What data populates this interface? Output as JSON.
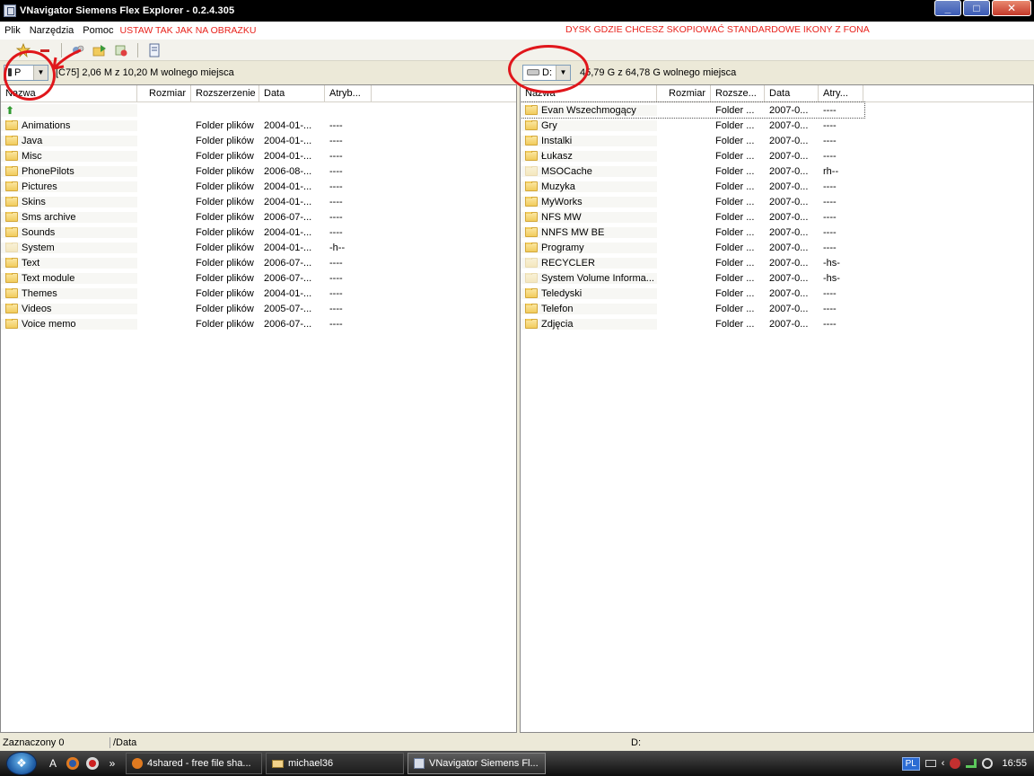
{
  "window": {
    "title": "VNavigator Siemens Flex Explorer - 0.2.4.305",
    "buttons": {
      "minimize": "_",
      "maximize": "□",
      "close": "✕"
    }
  },
  "menu": {
    "items": [
      "Plik",
      "Narzędzia",
      "Pomoc"
    ],
    "note_left": "USTAW TAK JAK NA OBRAZKU",
    "note_right": "DYSK GDZIE CHCESZ SKOPIOWAĆ STANDARDOWE IKONY Z FONA"
  },
  "left": {
    "drive": "P",
    "free": "[C75] 2,06 M z 10,20 M wolnego miejsca",
    "columns": [
      "Nazwa",
      "Rozmiar",
      "Rozszerzenie",
      "Data",
      "Atryb..."
    ],
    "rows": [
      {
        "name": "Animations",
        "size": "",
        "ext": "Folder plików",
        "date": "2004-01-...",
        "attr": "----"
      },
      {
        "name": "Java",
        "size": "",
        "ext": "Folder plików",
        "date": "2004-01-...",
        "attr": "----"
      },
      {
        "name": "Misc",
        "size": "",
        "ext": "Folder plików",
        "date": "2004-01-...",
        "attr": "----"
      },
      {
        "name": "PhonePilots",
        "size": "",
        "ext": "Folder plików",
        "date": "2006-08-...",
        "attr": "----"
      },
      {
        "name": "Pictures",
        "size": "",
        "ext": "Folder plików",
        "date": "2004-01-...",
        "attr": "----"
      },
      {
        "name": "Skins",
        "size": "",
        "ext": "Folder plików",
        "date": "2004-01-...",
        "attr": "----"
      },
      {
        "name": "Sms archive",
        "size": "",
        "ext": "Folder plików",
        "date": "2006-07-...",
        "attr": "----"
      },
      {
        "name": "Sounds",
        "size": "",
        "ext": "Folder plików",
        "date": "2004-01-...",
        "attr": "----"
      },
      {
        "name": "System",
        "size": "",
        "ext": "Folder plików",
        "date": "2004-01-...",
        "attr": "-h--"
      },
      {
        "name": "Text",
        "size": "",
        "ext": "Folder plików",
        "date": "2006-07-...",
        "attr": "----"
      },
      {
        "name": "Text module",
        "size": "",
        "ext": "Folder plików",
        "date": "2006-07-...",
        "attr": "----"
      },
      {
        "name": "Themes",
        "size": "",
        "ext": "Folder plików",
        "date": "2004-01-...",
        "attr": "----"
      },
      {
        "name": "Videos",
        "size": "",
        "ext": "Folder plików",
        "date": "2005-07-...",
        "attr": "----"
      },
      {
        "name": "Voice memo",
        "size": "",
        "ext": "Folder plików",
        "date": "2006-07-...",
        "attr": "----"
      }
    ],
    "status_selected": "Zaznaczony 0",
    "status_path": "/Data"
  },
  "right": {
    "drive": "D:",
    "free": "45,79 G z 64,78 G wolnego miejsca",
    "columns": [
      "Nazwa",
      "Rozmiar",
      "Rozsze...",
      "Data",
      "Atry..."
    ],
    "rows": [
      {
        "name": "Evan Wszechmogący",
        "size": "",
        "ext": "Folder ...",
        "date": "2007-0...",
        "attr": "----"
      },
      {
        "name": "Gry",
        "size": "",
        "ext": "Folder ...",
        "date": "2007-0...",
        "attr": "----"
      },
      {
        "name": "Instalki",
        "size": "",
        "ext": "Folder ...",
        "date": "2007-0...",
        "attr": "----"
      },
      {
        "name": "Łukasz",
        "size": "",
        "ext": "Folder ...",
        "date": "2007-0...",
        "attr": "----"
      },
      {
        "name": "MSOCache",
        "size": "",
        "ext": "Folder ...",
        "date": "2007-0...",
        "attr": "rh--"
      },
      {
        "name": "Muzyka",
        "size": "",
        "ext": "Folder ...",
        "date": "2007-0...",
        "attr": "----"
      },
      {
        "name": "MyWorks",
        "size": "",
        "ext": "Folder ...",
        "date": "2007-0...",
        "attr": "----"
      },
      {
        "name": "NFS MW",
        "size": "",
        "ext": "Folder ...",
        "date": "2007-0...",
        "attr": "----"
      },
      {
        "name": "NNFS MW BE",
        "size": "",
        "ext": "Folder ...",
        "date": "2007-0...",
        "attr": "----"
      },
      {
        "name": "Programy",
        "size": "",
        "ext": "Folder ...",
        "date": "2007-0...",
        "attr": "----"
      },
      {
        "name": "RECYCLER",
        "size": "",
        "ext": "Folder ...",
        "date": "2007-0...",
        "attr": "-hs-"
      },
      {
        "name": "System Volume Informa...",
        "size": "",
        "ext": "Folder ...",
        "date": "2007-0...",
        "attr": "-hs-"
      },
      {
        "name": "Teledyski",
        "size": "",
        "ext": "Folder ...",
        "date": "2007-0...",
        "attr": "----"
      },
      {
        "name": "Telefon",
        "size": "",
        "ext": "Folder ...",
        "date": "2007-0...",
        "attr": "----"
      },
      {
        "name": "Zdjęcia",
        "size": "",
        "ext": "Folder ...",
        "date": "2007-0...",
        "attr": "----"
      }
    ],
    "status_path": "D:"
  },
  "taskbar": {
    "chevron": "»",
    "tasks": [
      {
        "label": "4shared - free file sha..."
      },
      {
        "label": "michael36"
      },
      {
        "label": "VNavigator Siemens Fl..."
      }
    ],
    "lang": "PL",
    "clock": "16:55"
  },
  "colors": {
    "annotation": "#e0161b",
    "note_text": "#e8221c"
  }
}
